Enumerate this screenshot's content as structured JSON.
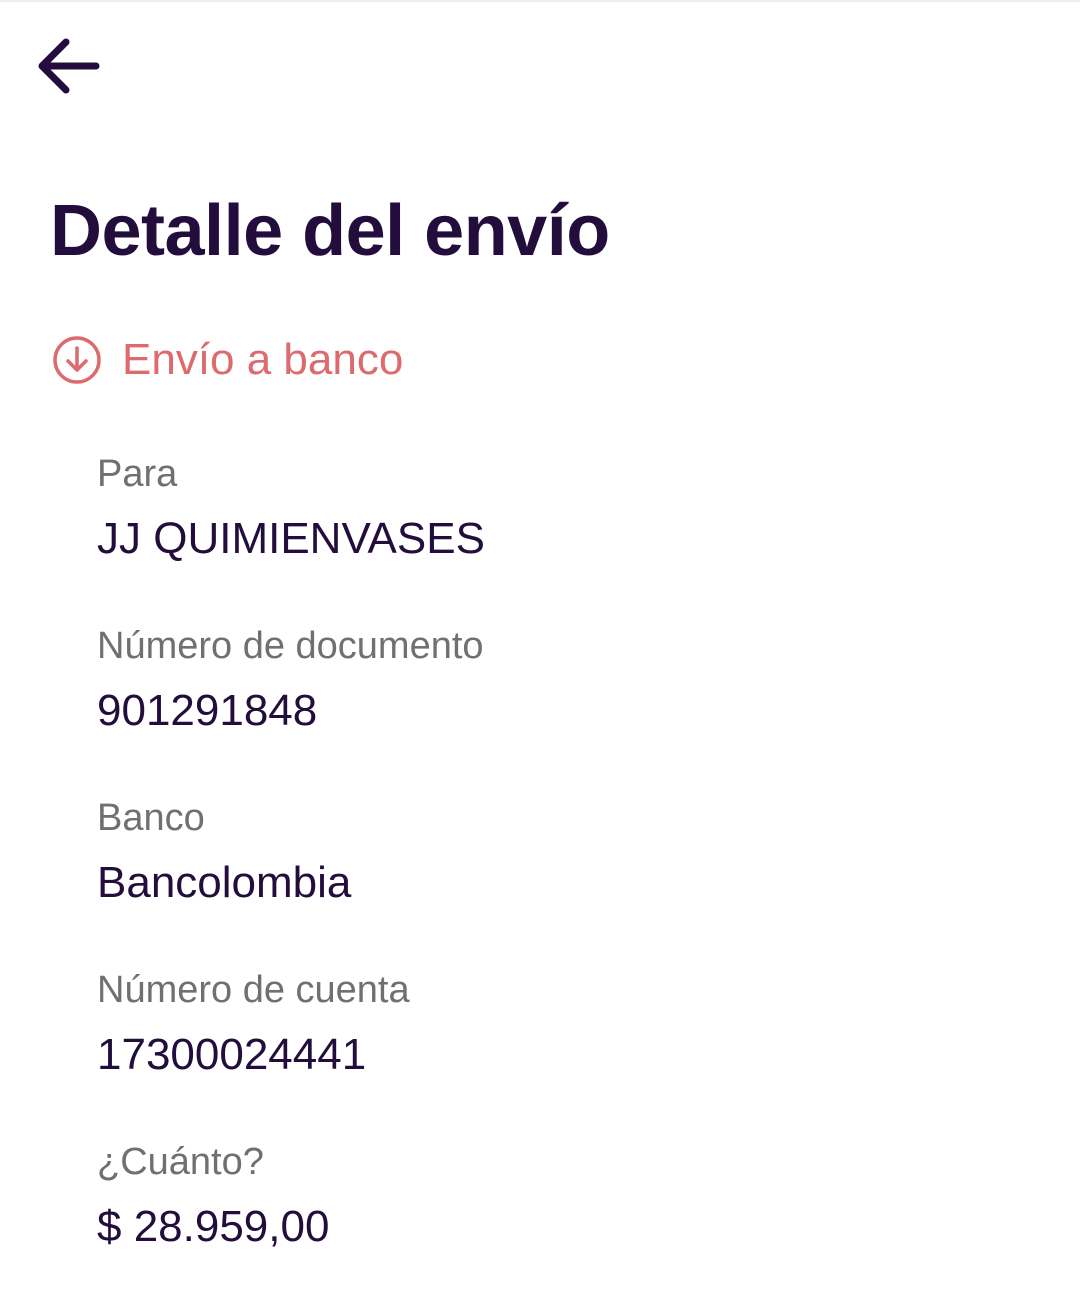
{
  "header": {
    "back_icon": "arrow-left-icon"
  },
  "page": {
    "title": "Detalle del envío"
  },
  "transfer_type": {
    "icon": "arrow-down-circle-icon",
    "label": "Envío a banco",
    "color": "#dd6a6c"
  },
  "details": {
    "recipient_label": "Para",
    "recipient_value": "JJ QUIMIENVASES",
    "document_label": "Número de documento",
    "document_value": "901291848",
    "bank_label": "Banco",
    "bank_value": "Bancolombia",
    "account_label": "Número de cuenta",
    "account_value": "17300024441",
    "amount_label": "¿Cuánto?",
    "amount_value": "$ 28.959,00"
  },
  "colors": {
    "primary_text": "#220d3c",
    "secondary_text": "#707070",
    "accent": "#dd6a6c",
    "background": "#ffffff"
  }
}
